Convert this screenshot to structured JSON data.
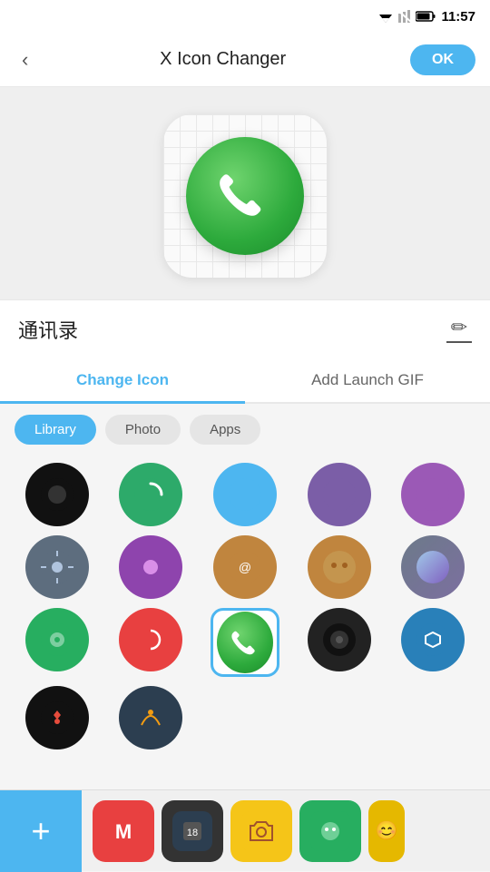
{
  "statusBar": {
    "time": "11:57"
  },
  "topBar": {
    "backLabel": "‹",
    "title": "X Icon Changer",
    "okLabel": "OK"
  },
  "appName": "通讯录",
  "tabs": [
    {
      "id": "change-icon",
      "label": "Change Icon",
      "active": true
    },
    {
      "id": "add-launch-gif",
      "label": "Add Launch GIF",
      "active": false
    }
  ],
  "filterPills": [
    {
      "id": "library",
      "label": "Library",
      "active": true
    },
    {
      "id": "photo",
      "label": "Photo",
      "active": false
    },
    {
      "id": "apps",
      "label": "Apps",
      "active": false
    }
  ],
  "icons": [
    {
      "id": 1,
      "bg": "#222",
      "shape": "circle",
      "selected": false
    },
    {
      "id": 2,
      "bg": "#2daa6a",
      "shape": "circle",
      "selected": false
    },
    {
      "id": 3,
      "bg": "#4db6f0",
      "shape": "circle",
      "selected": false
    },
    {
      "id": 4,
      "bg": "#7b5ea7",
      "shape": "circle",
      "selected": false
    },
    {
      "id": 5,
      "bg": "#9b59b6",
      "shape": "circle",
      "selected": false
    },
    {
      "id": 6,
      "bg": "#6c7a89",
      "shape": "circle",
      "selected": false
    },
    {
      "id": 7,
      "bg": "#8e44ad",
      "shape": "circle",
      "selected": false
    },
    {
      "id": 8,
      "bg": "#c0853e",
      "shape": "circle",
      "selected": false
    },
    {
      "id": 9,
      "bg": "#c0853e",
      "shape": "circle",
      "selected": false
    },
    {
      "id": 10,
      "bg": "#7c6fa0",
      "shape": "circle",
      "selected": false
    },
    {
      "id": 11,
      "bg": "#27ae60",
      "shape": "circle",
      "selected": false
    },
    {
      "id": 12,
      "bg": "#e84040",
      "shape": "circle",
      "selected": false
    },
    {
      "id": 13,
      "bg": "#2daa3c",
      "shape": "circle",
      "selected": true
    },
    {
      "id": 14,
      "bg": "#222",
      "shape": "circle",
      "selected": false
    },
    {
      "id": 15,
      "bg": "#2980b9",
      "shape": "circle",
      "selected": false
    },
    {
      "id": 16,
      "bg": "#222",
      "shape": "circle",
      "selected": false
    },
    {
      "id": 17,
      "bg": "#555",
      "shape": "circle",
      "selected": false
    }
  ],
  "bottomIcons": [
    {
      "id": "m1",
      "bg": "#e84040"
    },
    {
      "id": "chip",
      "bg": "#444"
    },
    {
      "id": "camera",
      "bg": "#f5c518"
    },
    {
      "id": "green1",
      "bg": "#2daa3c"
    },
    {
      "id": "yellow1",
      "bg": "#e5c000"
    }
  ],
  "colors": {
    "accent": "#4db6f0",
    "selectedBorder": "#4db6f0"
  }
}
